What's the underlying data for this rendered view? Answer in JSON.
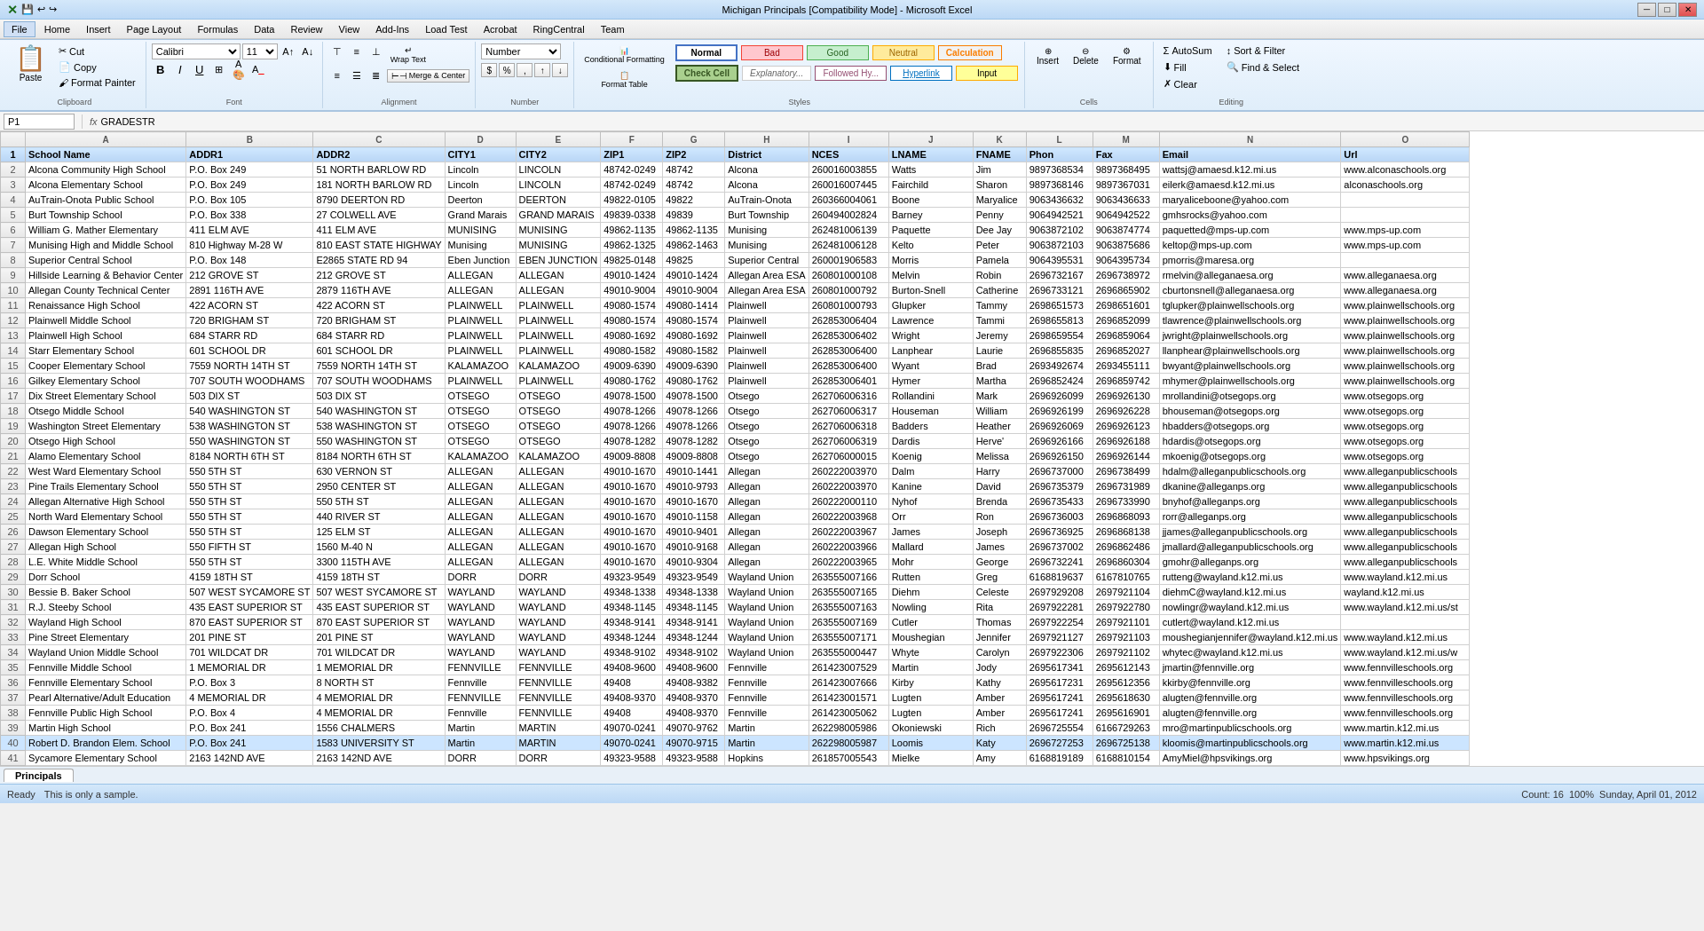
{
  "app": {
    "title": "Michigan Principals [Compatibility Mode] - Microsoft Excel",
    "titlebar_icons": [
      "minimize",
      "restore",
      "close"
    ]
  },
  "menu": {
    "items": [
      "File",
      "Home",
      "Insert",
      "Page Layout",
      "Formulas",
      "Data",
      "Review",
      "View",
      "Add-Ins",
      "Load Test",
      "Acrobat",
      "RingCentral",
      "Team"
    ]
  },
  "ribbon": {
    "active_tab": "Home",
    "tabs": [
      "File",
      "Home",
      "Insert",
      "Page Layout",
      "Formulas",
      "Data",
      "Review",
      "View",
      "Add-Ins",
      "Load Test",
      "Acrobat",
      "RingCentral",
      "Team"
    ],
    "clipboard": {
      "paste_label": "Paste",
      "cut_label": "Cut",
      "copy_label": "Copy",
      "format_painter_label": "Format Painter"
    },
    "font": {
      "face": "Calibri",
      "size": "11",
      "bold": "B",
      "italic": "I",
      "underline": "U"
    },
    "alignment": {
      "wrap_text": "Wrap Text",
      "merge_label": "Merge & Center"
    },
    "number": {
      "format": "Number"
    },
    "styles": {
      "normal": "Normal",
      "bad": "Bad",
      "good": "Good",
      "neutral": "Neutral",
      "calculation": "Calculation",
      "explanatory": "Explanatory...",
      "followed_hy": "Followed Hy...",
      "hyperlink": "Hyperlink",
      "check_cell": "Check Cell",
      "input": "Input"
    },
    "cells": {
      "insert": "Insert",
      "delete": "Delete",
      "format": "Format"
    },
    "editing": {
      "autosum": "AutoSum",
      "fill": "Fill",
      "clear": "Clear",
      "sort_filter": "Sort & Filter",
      "find_select": "Find & Select"
    },
    "format_table_label": "Format Table",
    "cond_format_label": "Conditional Formatting"
  },
  "formula_bar": {
    "name_box": "P1",
    "formula": "GRADESTR"
  },
  "columns": [
    "A",
    "B",
    "C",
    "D",
    "E",
    "F",
    "G",
    "H",
    "I",
    "J",
    "K",
    "L",
    "M",
    "N",
    "O"
  ],
  "col_labels": [
    "School Name",
    "ADDR1",
    "ADDR2",
    "CITY1",
    "CITY2",
    "ZIP1",
    "ZIP2",
    "District",
    "NCES",
    "LNAME",
    "FNAME",
    "Phon",
    "Fax",
    "Email",
    "Url"
  ],
  "rows": [
    [
      "Alcona Community High School",
      "P.O. Box 249",
      "51 NORTH BARLOW RD",
      "Lincoln",
      "LINCOLN",
      "48742-0249",
      "48742",
      "Alcona",
      "260016003855",
      "Watts",
      "Jim",
      "9897368534",
      "9897368495",
      "wattsj@amaesd.k12.mi.us",
      "www.alconaschools.org"
    ],
    [
      "Alcona Elementary School",
      "P.O. Box 249",
      "181 NORTH BARLOW RD",
      "Lincoln",
      "LINCOLN",
      "48742-0249",
      "48742",
      "Alcona",
      "260016007445",
      "Fairchild",
      "Sharon",
      "9897368146",
      "9897367031",
      "eilerk@amaesd.k12.mi.us",
      "alconaschools.org"
    ],
    [
      "AuTrain-Onota Public School",
      "P.O. Box 105",
      "8790 DEERTON RD",
      "Deerton",
      "DEERTON",
      "49822-0105",
      "49822",
      "AuTrain-Onota",
      "260366004061",
      "Boone",
      "Maryalice",
      "9063436632",
      "9063436633",
      "maryaliceboone@yahoo.com",
      ""
    ],
    [
      "Burt Township School",
      "P.O. Box 338",
      "27 COLWELL AVE",
      "Grand Marais",
      "GRAND MARAIS",
      "49839-0338",
      "49839",
      "Burt Township",
      "260494002824",
      "Barney",
      "Penny",
      "9064942521",
      "9064942522",
      "gmhsrocks@yahoo.com",
      ""
    ],
    [
      "William G. Mather Elementary",
      "411 ELM AVE",
      "411 ELM AVE",
      "MUNISING",
      "MUNISING",
      "49862-1135",
      "49862-1135",
      "Munising",
      "262481006139",
      "Paquette",
      "Dee Jay",
      "9063872102",
      "9063874774",
      "paquetted@mps-up.com",
      "www.mps-up.com"
    ],
    [
      "Munising High and Middle School",
      "810 Highway M-28 W",
      "810 EAST STATE HIGHWAY",
      "Munising",
      "MUNISING",
      "49862-1325",
      "49862-1463",
      "Munising",
      "262481006128",
      "Kelto",
      "Peter",
      "9063872103",
      "9063875686",
      "keltop@mps-up.com",
      "www.mps-up.com"
    ],
    [
      "Superior Central School",
      "P.O. Box 148",
      "E2865 STATE RD 94",
      "Eben Junction",
      "EBEN JUNCTION",
      "49825-0148",
      "49825",
      "Superior Central",
      "260001906583",
      "Morris",
      "Pamela",
      "9064395531",
      "9064395734",
      "pmorris@maresa.org",
      ""
    ],
    [
      "Hillside Learning & Behavior Center",
      "212 GROVE ST",
      "212 GROVE ST",
      "ALLEGAN",
      "ALLEGAN",
      "49010-1424",
      "49010-1424",
      "Allegan Area ESA",
      "260801000108",
      "Melvin",
      "Robin",
      "2696732167",
      "2696738972",
      "rmelvin@alleganaesa.org",
      "www.alleganaesa.org"
    ],
    [
      "Allegan County Technical Center",
      "2891 116TH AVE",
      "2879 116TH AVE",
      "ALLEGAN",
      "ALLEGAN",
      "49010-9004",
      "49010-9004",
      "Allegan Area ESA",
      "260801000792",
      "Burton-Snell",
      "Catherine",
      "2696733121",
      "2696865902",
      "cburtonsnell@alleganaesa.org",
      "www.alleganaesa.org"
    ],
    [
      "Renaissance High School",
      "422 ACORN ST",
      "422 ACORN ST",
      "PLAINWELL",
      "PLAINWELL",
      "49080-1574",
      "49080-1414",
      "Plainwell",
      "260801000793",
      "Glupker",
      "Tammy",
      "2698651573",
      "2698651601",
      "tglupker@plainwellschools.org",
      "www.plainwellschools.org"
    ],
    [
      "Plainwell Middle School",
      "720 BRIGHAM ST",
      "720 BRIGHAM ST",
      "PLAINWELL",
      "PLAINWELL",
      "49080-1574",
      "49080-1574",
      "Plainwell",
      "262853006404",
      "Lawrence",
      "Tammi",
      "2698655813",
      "2696852099",
      "tlawrence@plainwellschools.org",
      "www.plainwellschools.org"
    ],
    [
      "Plainwell High School",
      "684 STARR RD",
      "684 STARR RD",
      "PLAINWELL",
      "PLAINWELL",
      "49080-1692",
      "49080-1692",
      "Plainwell",
      "262853006402",
      "Wright",
      "Jeremy",
      "2698659554",
      "2696859064",
      "jwright@plainwellschools.org",
      "www.plainwellschools.org"
    ],
    [
      "Starr Elementary School",
      "601 SCHOOL DR",
      "601 SCHOOL DR",
      "PLAINWELL",
      "PLAINWELL",
      "49080-1582",
      "49080-1582",
      "Plainwell",
      "262853006400",
      "Lanphear",
      "Laurie",
      "2696855835",
      "2696852027",
      "llanphear@plainwellschools.org",
      "www.plainwellschools.org"
    ],
    [
      "Cooper Elementary School",
      "7559 NORTH 14TH ST",
      "7559 NORTH 14TH ST",
      "KALAMAZOO",
      "KALAMAZOO",
      "49009-6390",
      "49009-6390",
      "Plainwell",
      "262853006400",
      "Wyant",
      "Brad",
      "2693492674",
      "2693455111",
      "bwyant@plainwellschools.org",
      "www.plainwellschools.org"
    ],
    [
      "Gilkey Elementary School",
      "707 SOUTH WOODHAMS",
      "707 SOUTH WOODHAMS",
      "PLAINWELL",
      "PLAINWELL",
      "49080-1762",
      "49080-1762",
      "Plainwell",
      "262853006401",
      "Hymer",
      "Martha",
      "2696852424",
      "2696859742",
      "mhymer@plainwellschools.org",
      "www.plainwellschools.org"
    ],
    [
      "Dix Street Elementary School",
      "503 DIX ST",
      "503 DIX ST",
      "OTSEGO",
      "OTSEGO",
      "49078-1500",
      "49078-1500",
      "Otsego",
      "262706006316",
      "Rollandini",
      "Mark",
      "2696926099",
      "2696926130",
      "mrollandini@otsegops.org",
      "www.otsegops.org"
    ],
    [
      "Otsego Middle School",
      "540 WASHINGTON ST",
      "540 WASHINGTON ST",
      "OTSEGO",
      "OTSEGO",
      "49078-1266",
      "49078-1266",
      "Otsego",
      "262706006317",
      "Houseman",
      "William",
      "2696926199",
      "2696926228",
      "bhouseman@otsegops.org",
      "www.otsegops.org"
    ],
    [
      "Washington Street Elementary",
      "538 WASHINGTON ST",
      "538 WASHINGTON ST",
      "OTSEGO",
      "OTSEGO",
      "49078-1266",
      "49078-1266",
      "Otsego",
      "262706006318",
      "Badders",
      "Heather",
      "2696926069",
      "2696926123",
      "hbadders@otsegops.org",
      "www.otsegops.org"
    ],
    [
      "Otsego High School",
      "550 WASHINGTON ST",
      "550 WASHINGTON ST",
      "OTSEGO",
      "OTSEGO",
      "49078-1282",
      "49078-1282",
      "Otsego",
      "262706006319",
      "Dardis",
      "Herve'",
      "2696926166",
      "2696926188",
      "hdardis@otsegops.org",
      "www.otsegops.org"
    ],
    [
      "Alamo Elementary School",
      "8184 NORTH 6TH ST",
      "8184 NORTH 6TH ST",
      "KALAMAZOO",
      "KALAMAZOO",
      "49009-8808",
      "49009-8808",
      "Otsego",
      "262706000015",
      "Koenig",
      "Melissa",
      "2696926150",
      "2696926144",
      "mkoenig@otsegops.org",
      "www.otsegops.org"
    ],
    [
      "West Ward Elementary School",
      "550 5TH ST",
      "630 VERNON ST",
      "ALLEGAN",
      "ALLEGAN",
      "49010-1670",
      "49010-1441",
      "Allegan",
      "260222003970",
      "Dalm",
      "Harry",
      "2696737000",
      "2696738499",
      "hdalm@alleganpublicschools.org",
      "www.alleganpublicschools"
    ],
    [
      "Pine Trails Elementary School",
      "550 5TH ST",
      "2950 CENTER ST",
      "ALLEGAN",
      "ALLEGAN",
      "49010-1670",
      "49010-9793",
      "Allegan",
      "260222003970",
      "Kanine",
      "David",
      "2696735379",
      "2696731989",
      "dkanine@alleganps.org",
      "www.alleganpublicschools"
    ],
    [
      "Allegan Alternative High School",
      "550 5TH ST",
      "550 5TH ST",
      "ALLEGAN",
      "ALLEGAN",
      "49010-1670",
      "49010-1670",
      "Allegan",
      "260222000110",
      "Nyhof",
      "Brenda",
      "2696735433",
      "2696733990",
      "bnyhof@alleganps.org",
      "www.alleganpublicschools"
    ],
    [
      "North Ward Elementary School",
      "550 5TH ST",
      "440 RIVER ST",
      "ALLEGAN",
      "ALLEGAN",
      "49010-1670",
      "49010-1158",
      "Allegan",
      "260222003968",
      "Orr",
      "Ron",
      "2696736003",
      "2696868093",
      "rorr@alleganps.org",
      "www.alleganpublicschools"
    ],
    [
      "Dawson Elementary School",
      "550 5TH ST",
      "125 ELM ST",
      "ALLEGAN",
      "ALLEGAN",
      "49010-1670",
      "49010-9401",
      "Allegan",
      "260222003967",
      "James",
      "Joseph",
      "2696736925",
      "2696868138",
      "jjames@alleganpublicschools.org",
      "www.alleganpublicschools"
    ],
    [
      "Allegan High School",
      "550 FIFTH ST",
      "1560 M-40 N",
      "ALLEGAN",
      "ALLEGAN",
      "49010-1670",
      "49010-9168",
      "Allegan",
      "260222003966",
      "Mallard",
      "James",
      "2696737002",
      "2696862486",
      "jmallard@alleganpublicschools.org",
      "www.alleganpublicschools"
    ],
    [
      "L.E. White Middle School",
      "550 5TH ST",
      "3300 115TH AVE",
      "ALLEGAN",
      "ALLEGAN",
      "49010-1670",
      "49010-9304",
      "Allegan",
      "260222003965",
      "Mohr",
      "George",
      "2696732241",
      "2696860304",
      "gmohr@alleganps.org",
      "www.alleganpublicschools"
    ],
    [
      "Dorr School",
      "4159 18TH ST",
      "4159 18TH ST",
      "DORR",
      "DORR",
      "49323-9549",
      "49323-9549",
      "Wayland Union",
      "263555007166",
      "Rutten",
      "Greg",
      "6168819637",
      "6167810765",
      "rutteng@wayland.k12.mi.us",
      "www.wayland.k12.mi.us"
    ],
    [
      "Bessie B. Baker School",
      "507 WEST SYCAMORE ST",
      "507 WEST SYCAMORE ST",
      "WAYLAND",
      "WAYLAND",
      "49348-1338",
      "49348-1338",
      "Wayland Union",
      "263555007165",
      "Diehm",
      "Celeste",
      "2697929208",
      "2697921104",
      "diehmC@wayland.k12.mi.us",
      "wayland.k12.mi.us"
    ],
    [
      "R.J. Steeby School",
      "435 EAST SUPERIOR ST",
      "435 EAST SUPERIOR ST",
      "WAYLAND",
      "WAYLAND",
      "49348-1145",
      "49348-1145",
      "Wayland Union",
      "263555007163",
      "Nowling",
      "Rita",
      "2697922281",
      "2697922780",
      "nowlingr@wayland.k12.mi.us",
      "www.wayland.k12.mi.us/st"
    ],
    [
      "Wayland High School",
      "870 EAST SUPERIOR ST",
      "870 EAST SUPERIOR ST",
      "WAYLAND",
      "WAYLAND",
      "49348-9141",
      "49348-9141",
      "Wayland Union",
      "263555007169",
      "Cutler",
      "Thomas",
      "2697922254",
      "2697921101",
      "cutlert@wayland.k12.mi.us",
      ""
    ],
    [
      "Pine Street Elementary",
      "201 PINE ST",
      "201 PINE ST",
      "WAYLAND",
      "WAYLAND",
      "49348-1244",
      "49348-1244",
      "Wayland Union",
      "263555007171",
      "Moushegian",
      "Jennifer",
      "2697921127",
      "2697921103",
      "moushegianjennifer@wayland.k12.mi.us",
      "www.wayland.k12.mi.us"
    ],
    [
      "Wayland Union Middle School",
      "701 WILDCAT DR",
      "701 WILDCAT DR",
      "WAYLAND",
      "WAYLAND",
      "49348-9102",
      "49348-9102",
      "Wayland Union",
      "263555000447",
      "Whyte",
      "Carolyn",
      "2697922306",
      "2697921102",
      "whytec@wayland.k12.mi.us",
      "www.wayland.k12.mi.us/w"
    ],
    [
      "Fennville Middle School",
      "1 MEMORIAL DR",
      "1 MEMORIAL DR",
      "FENNVILLE",
      "FENNVILLE",
      "49408-9600",
      "49408-9600",
      "Fennville",
      "261423007529",
      "Martin",
      "Jody",
      "2695617341",
      "2695612143",
      "jmartin@fennville.org",
      "www.fennvilleschools.org"
    ],
    [
      "Fennville Elementary School",
      "P.O. Box 3",
      "8 NORTH ST",
      "Fennville",
      "FENNVILLE",
      "49408",
      "49408-9382",
      "Fennville",
      "261423007666",
      "Kirby",
      "Kathy",
      "2695617231",
      "2695612356",
      "kkirby@fennville.org",
      "www.fennvilleschools.org"
    ],
    [
      "Pearl Alternative/Adult Education",
      "4 MEMORIAL DR",
      "4 MEMORIAL DR",
      "FENNVILLE",
      "FENNVILLE",
      "49408-9370",
      "49408-9370",
      "Fennville",
      "261423001571",
      "Lugten",
      "Amber",
      "2695617241",
      "2695618630",
      "alugten@fennville.org",
      "www.fennvilleschools.org"
    ],
    [
      "Fennville Public High School",
      "P.O. Box 4",
      "4 MEMORIAL DR",
      "Fennville",
      "FENNVILLE",
      "49408",
      "49408-9370",
      "Fennville",
      "261423005062",
      "Lugten",
      "Amber",
      "2695617241",
      "2695616901",
      "alugten@fennville.org",
      "www.fennvilleschools.org"
    ],
    [
      "Martin High School",
      "P.O. Box 241",
      "1556 CHALMERS",
      "Martin",
      "MARTIN",
      "49070-0241",
      "49070-9762",
      "Martin",
      "262298005986",
      "Okoniewski",
      "Rich",
      "2696725554",
      "6166729263",
      "mro@martinpublicschools.org",
      "www.martin.k12.mi.us"
    ],
    [
      "Robert D. Brandon Elem. School",
      "P.O. Box 241",
      "1583 UNIVERSITY ST",
      "Martin",
      "MARTIN",
      "49070-0241",
      "49070-9715",
      "Martin",
      "262298005987",
      "Loomis",
      "Katy",
      "2696727253",
      "2696725138",
      "kloomis@martinpublicschools.org",
      "www.martin.k12.mi.us"
    ],
    [
      "Sycamore Elementary School",
      "2163 142ND AVE",
      "2163 142ND AVE",
      "DORR",
      "DORR",
      "49323-9588",
      "49323-9588",
      "Hopkins",
      "261857005543",
      "Mielke",
      "Amy",
      "6168819189",
      "6168810154",
      "AmyMiel@hpsvikings.org",
      "www.hpsvikings.org"
    ]
  ],
  "statusbar": {
    "ready": "Ready",
    "sample_text": "This is only a sample.",
    "count": "Count: 16",
    "zoom": "100%",
    "date": "Sunday, April 01, 2012"
  },
  "sheet_tabs": [
    "Principals"
  ],
  "active_sheet": "Principals"
}
